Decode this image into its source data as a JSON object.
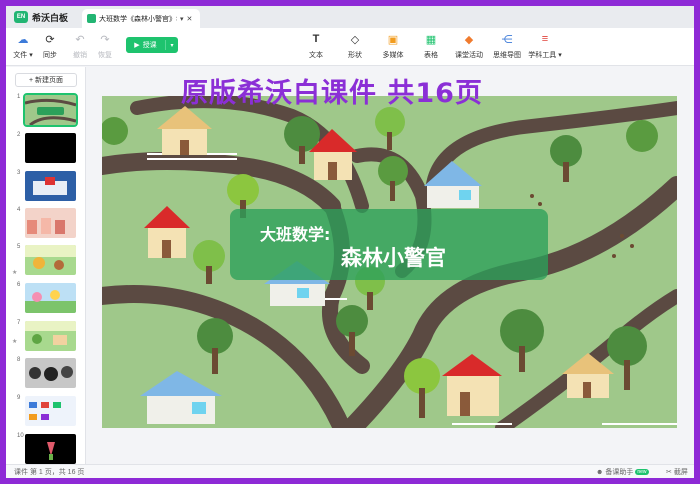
{
  "app": {
    "name": "希沃白板",
    "logo": "EN"
  },
  "tab": {
    "title": "大班数学《森林小警官》希...",
    "dropdown": "▾",
    "close": "✕"
  },
  "toolbar_left": [
    {
      "name": "file",
      "label": "文件 ▾",
      "icon": "☁"
    },
    {
      "name": "sync",
      "label": "同步",
      "icon": "⟳"
    },
    {
      "name": "undo",
      "label": "撤销",
      "icon": "↶"
    },
    {
      "name": "redo",
      "label": "恢复",
      "icon": "↷"
    }
  ],
  "play_button": {
    "label": "授课",
    "icon": "▶",
    "dropdown": "▾"
  },
  "toolbar_right": [
    {
      "name": "text",
      "label": "文本",
      "icon": "T"
    },
    {
      "name": "shape",
      "label": "形状",
      "icon": "◇"
    },
    {
      "name": "multimedia",
      "label": "多媒体",
      "icon": "▣"
    },
    {
      "name": "table",
      "label": "表格",
      "icon": "▦"
    },
    {
      "name": "class-activity",
      "label": "课堂活动",
      "icon": "◆"
    },
    {
      "name": "mind-map",
      "label": "思维导图",
      "icon": "⋲"
    },
    {
      "name": "subject-tools",
      "label": "学科工具 ▾",
      "icon": "≡"
    }
  ],
  "new_page": {
    "label": "新建页面",
    "icon": "+"
  },
  "thumbnails": [
    "1",
    "2",
    "3",
    "4",
    "5",
    "6",
    "7",
    "8",
    "9",
    "10"
  ],
  "slide": {
    "banner": "原版希沃白课件 共16页",
    "title_line1": "大班数学:",
    "title_line2": "森林小警官"
  },
  "status": {
    "page_info": "课件 第 1 页，共 16 页",
    "assistant": "备课助手",
    "assistant_badge": "new",
    "screenshot": "截屏"
  }
}
